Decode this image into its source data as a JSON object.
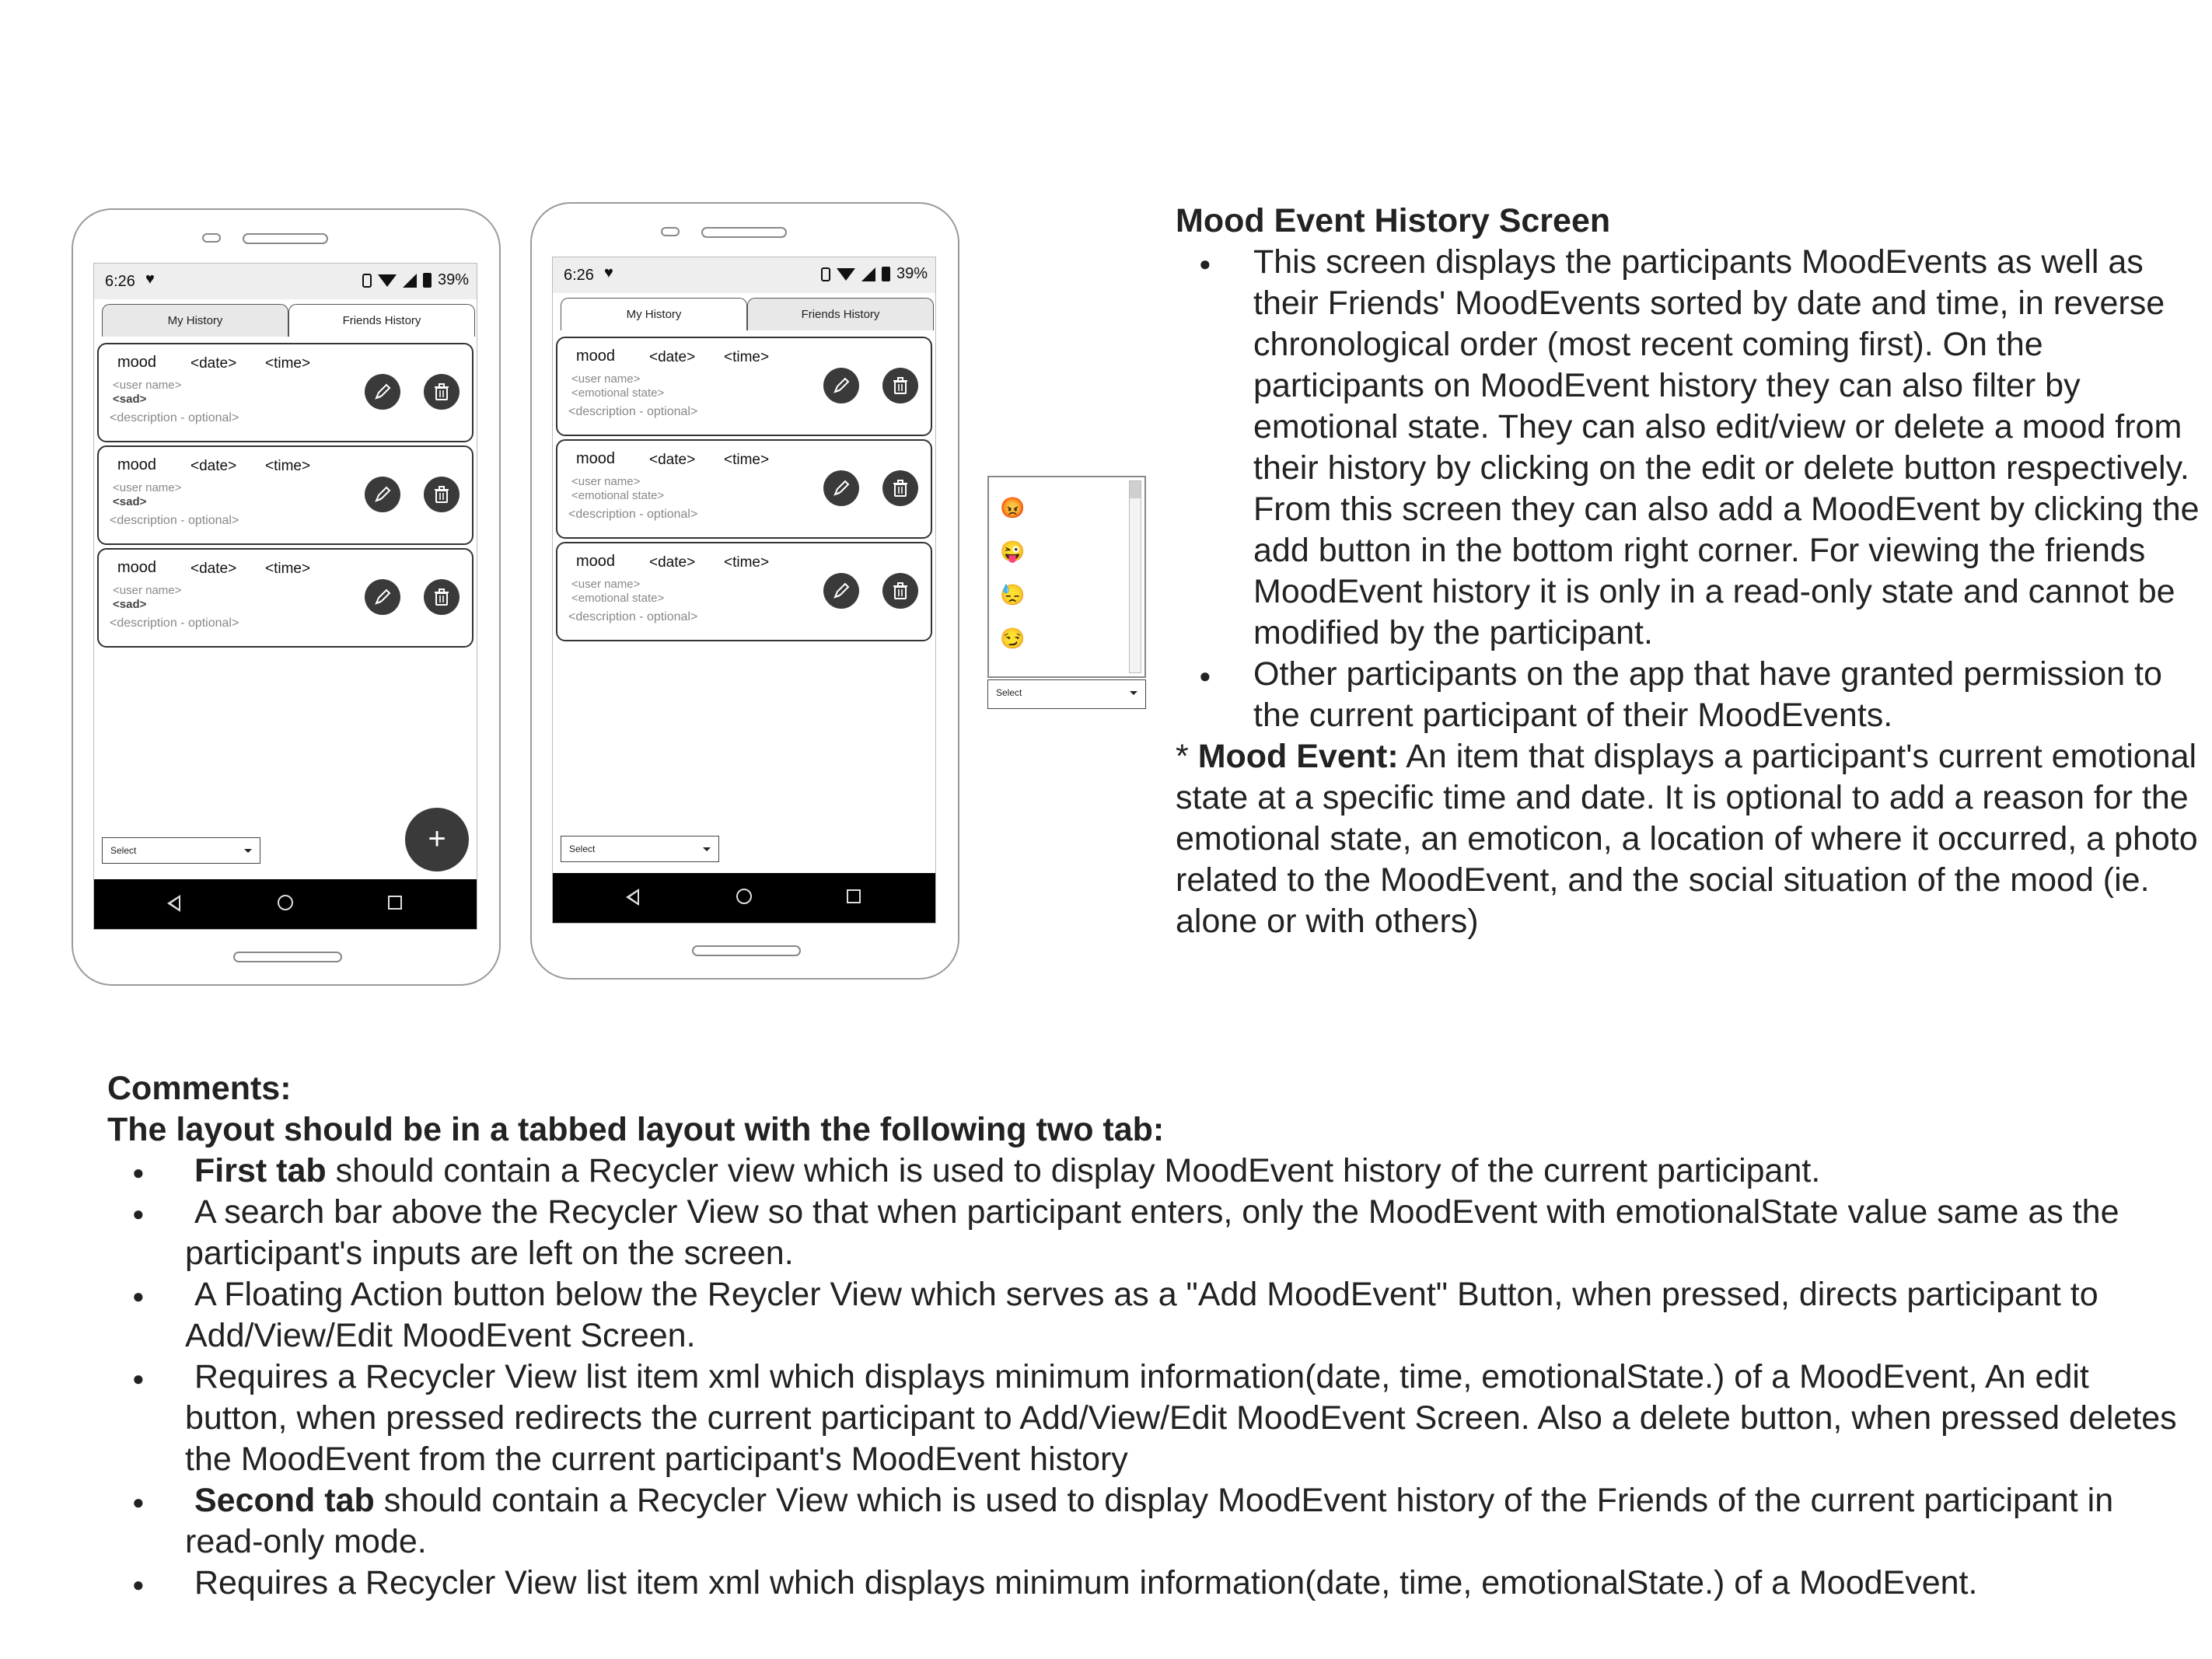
{
  "phones": [
    {
      "status": {
        "time": "6:26",
        "battery": "39%"
      },
      "tabs": {
        "my": "My History",
        "friends": "Friends History",
        "selected": "my"
      },
      "cards": [
        {
          "mood": "mood",
          "date": "<date>",
          "time": "<time>",
          "user": "<user name>",
          "state": "<sad>",
          "description": "<description - optional>"
        },
        {
          "mood": "mood",
          "date": "<date>",
          "time": "<time>",
          "user": "<user name>",
          "state": "<sad>",
          "description": "<description - optional>"
        },
        {
          "mood": "mood",
          "date": "<date>",
          "time": "<time>",
          "user": "<user name>",
          "state": "<sad>",
          "description": "<description - optional>"
        }
      ],
      "select": "Select",
      "fab": "+"
    },
    {
      "status": {
        "time": "6:26",
        "battery": "39%"
      },
      "tabs": {
        "my": "My History",
        "friends": "Friends History",
        "selected": "friends"
      },
      "cards": [
        {
          "mood": "mood",
          "date": "<date>",
          "time": "<time>",
          "user": "<user name>",
          "state": "<emotional state>",
          "description": "<description - optional>"
        },
        {
          "mood": "mood",
          "date": "<date>",
          "time": "<time>",
          "user": "<user name>",
          "state": "<emotional state>",
          "description": "<description - optional>"
        },
        {
          "mood": "mood",
          "date": "<date>",
          "time": "<time>",
          "user": "<user name>",
          "state": "<emotional state>",
          "description": "<description - optional>"
        }
      ],
      "select": "Select"
    }
  ],
  "emoji_dropdown": {
    "options": [
      "😡",
      "😜",
      "😓",
      "😏"
    ],
    "select": "Select"
  },
  "description": {
    "title": "Mood Event History Screen",
    "bullet1": "This screen displays the participants MoodEvents as well as their Friends' MoodEvents sorted by date and time, in reverse chronological order (most recent coming first). On the participants on MoodEvent history they can also filter by emotional state. They can also edit/view or delete a mood from their history by clicking on the edit or delete button respectively. From this screen they can also add a MoodEvent by clicking the add button in the bottom right corner. For viewing the friends MoodEvent history it is only in a read-only state and cannot be modified by the participant.",
    "bullet2": "Other participants on the app that have granted permission to the current participant of their MoodEvents.",
    "note_prefix": "* ",
    "note_bold": "Mood Event:",
    "note_text": " An item that displays a participant's current emotional state at a specific time and date. It is optional to add a reason for the emotional state, an emoticon, a location of where it occurred, a photo related to the MoodEvent, and the social situation of the mood (ie. alone or with others)"
  },
  "comments": {
    "title": "Comments:",
    "subtitle": "The layout should be in a tabbed layout with the following two tab:",
    "items": [
      {
        "bold": "First tab",
        "text": " should contain a Recycler view which is used to display MoodEvent history of the current participant."
      },
      {
        "bold": "",
        "text": "A search bar above the Recycler View so that when participant enters, only the MoodEvent with emotionalState value same as the participant's inputs are left on the screen."
      },
      {
        "bold": "",
        "text": "A Floating Action button below the Reycler View which serves as a \"Add MoodEvent\" Button, when pressed, directs participant to Add/View/Edit MoodEvent Screen."
      },
      {
        "bold": "",
        "text": "Requires a Recycler View list item xml which displays minimum information(date, time, emotionalState.) of a MoodEvent, An edit button, when pressed redirects the current participant to Add/View/Edit MoodEvent Screen. Also a delete button, when pressed deletes the MoodEvent from the current participant's MoodEvent history"
      },
      {
        "bold": "Second tab",
        "text": " should contain a Recycler View which is used to display MoodEvent history of the Friends of the current participant in read-only mode."
      },
      {
        "bold": "",
        "text": "Requires a Recycler View list item xml which displays minimum information(date, time, emotionalState.) of a MoodEvent."
      }
    ]
  }
}
